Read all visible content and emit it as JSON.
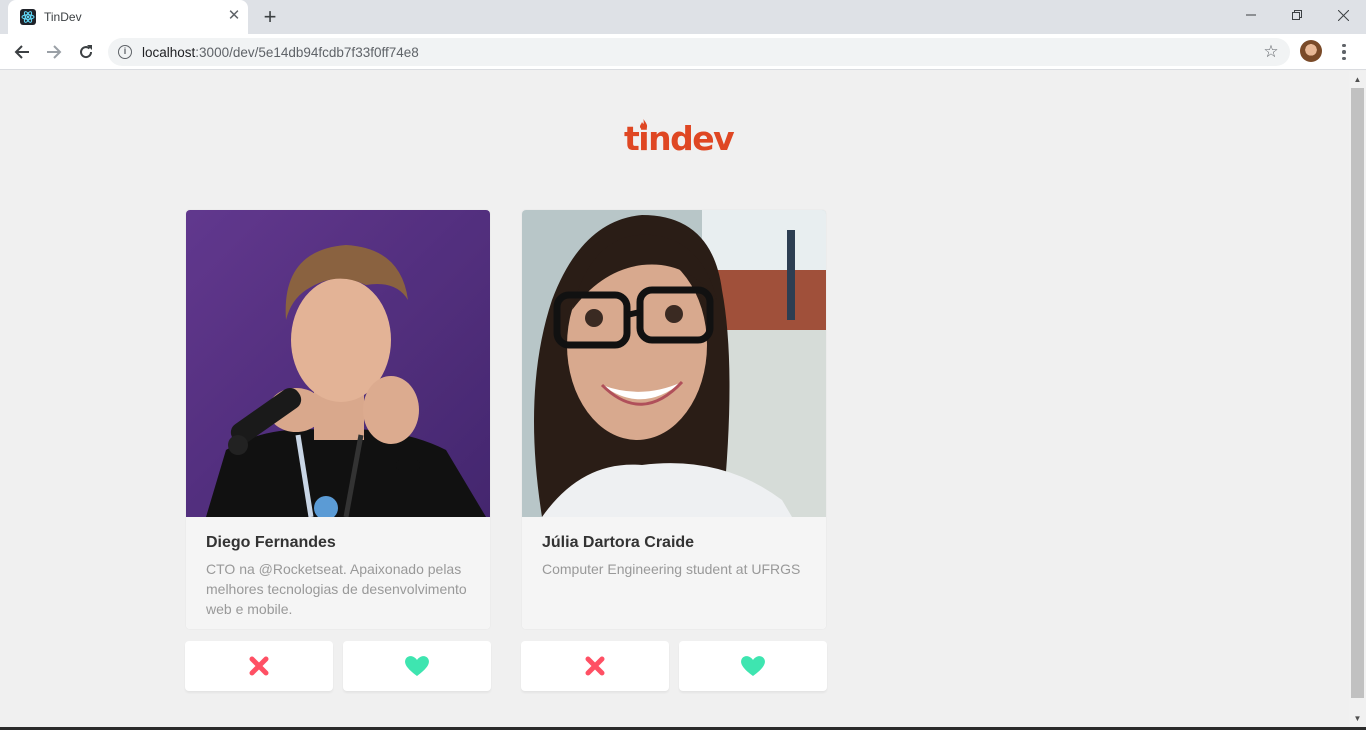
{
  "browser": {
    "tab_title": "TinDev",
    "url_host": "localhost",
    "url_path": ":3000/dev/5e14db94fcdb7f33f0ff74e8"
  },
  "app": {
    "logo_text": "tindev",
    "colors": {
      "brand": "#df4723",
      "dislike": "#ff5064",
      "like": "#3ee5b0"
    }
  },
  "devs": [
    {
      "name": "Diego Fernandes",
      "bio": "CTO na @Rocketseat. Apaixonado pelas melhores tecnologias de desenvolvimento web e mobile."
    },
    {
      "name": "Júlia Dartora Craide",
      "bio": "Computer Engineering student at UFRGS"
    }
  ],
  "icons": {
    "dislike": "dislike-x-icon",
    "like": "like-heart-icon"
  }
}
